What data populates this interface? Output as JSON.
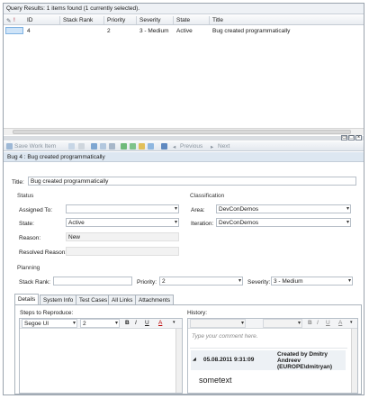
{
  "query": {
    "status": "Query Results: 1 items found (1 currently selected).",
    "columns": [
      "ID",
      "Stack Rank",
      "Priority",
      "Severity",
      "State",
      "Title"
    ],
    "rows": [
      {
        "id": "4",
        "stack_rank": "",
        "priority": "2",
        "severity": "3 - Medium",
        "state": "Active",
        "title": "Bug created programmatically"
      }
    ]
  },
  "toolbar": {
    "save_label": "Save Work Item",
    "previous_label": "Previous",
    "next_label": "Next"
  },
  "work_item": {
    "header": "Bug 4 : Bug created programmatically",
    "title_label": "Title:",
    "title_value": "Bug created programmatically",
    "status_section": "Status",
    "assigned_to_label": "Assigned To:",
    "assigned_to_value": "",
    "state_label": "State:",
    "state_value": "Active",
    "reason_label": "Reason:",
    "reason_value": "New",
    "resolved_reason_label": "Resolved Reason:",
    "resolved_reason_value": "",
    "classification_section": "Classification",
    "area_label": "Area:",
    "area_value": "DevConDemos",
    "iteration_label": "Iteration:",
    "iteration_value": "DevConDemos",
    "planning_section": "Planning",
    "stack_rank_label": "Stack Rank:",
    "stack_rank_value": "",
    "priority_label": "Priority:",
    "priority_value": "2",
    "severity_label": "Severity:",
    "severity_value": "3 - Medium"
  },
  "tabs": [
    "Details",
    "System Info",
    "Test Cases",
    "All Links",
    "Attachments"
  ],
  "details": {
    "steps_label": "Steps to Reproduce:",
    "history_label": "History:",
    "font_name": "Segoe UI",
    "font_size": "2",
    "bold": "B",
    "italic": "I",
    "underline": "U",
    "color_glyph": "A",
    "history_placeholder": "Type your comment here.",
    "history_entry": {
      "date": "05.08.2011 9:31:09",
      "author": "Created by Dmitry Andreev (EUROPE\\dmitryan)",
      "text": "sometext"
    }
  }
}
